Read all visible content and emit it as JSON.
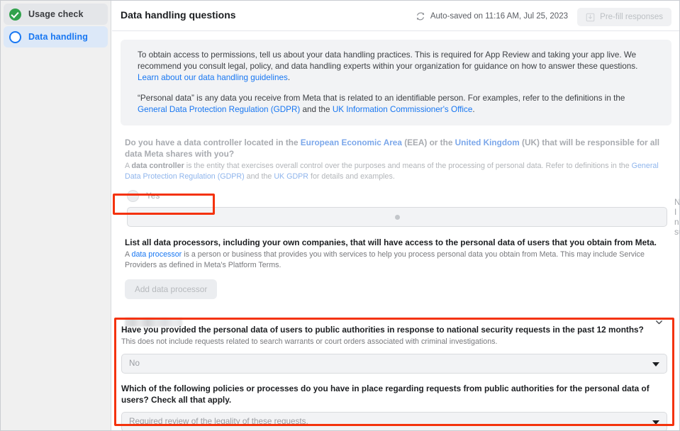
{
  "sidebar": {
    "items": [
      {
        "label": "Usage check",
        "icon": "check-circle-icon",
        "state": "done"
      },
      {
        "label": "Data handling",
        "icon": "empty-circle-icon",
        "state": "active"
      }
    ]
  },
  "header": {
    "title": "Data handling questions",
    "autosave_text": "Auto-saved on 11:16 AM, Jul 25, 2023",
    "autosave_icon": "refresh-icon",
    "prefill_label": "Pre-fill responses",
    "prefill_icon": "import-icon"
  },
  "info": {
    "p1_a": "To obtain access to permissions, tell us about your data handling practices. This is required for App Review and taking your app live. We recommend you consult legal, policy, and data handling experts within your organization for guidance on how to answer these questions. ",
    "p1_link": "Learn about our data handling guidelines",
    "p1_b": ".",
    "p2_a": "“Personal data” is any data you receive from Meta that is related to an identifiable person. For examples, refer to the definitions in the ",
    "p2_link1": "General Data Protection Regulation (GDPR)",
    "p2_mid": " and the ",
    "p2_link2": "UK Information Commissioner's Office",
    "p2_b": "."
  },
  "controller": {
    "title_a": "Do you have a data controller located in the ",
    "title_link1": "European Economic Area",
    "title_mid1": " (EEA) or the ",
    "title_link2": "United Kingdom",
    "title_b": " (UK) that will be responsible for all data Meta shares with you?",
    "sub_a": "A ",
    "sub_bold": "data controller",
    "sub_b": " is the entity that exercises overall control over the purposes and means of the processing of personal data. Refer to definitions in the ",
    "sub_link1": "General Data Protection Regulation (GDPR)",
    "sub_mid": " and the ",
    "sub_link2": "UK GDPR",
    "sub_c": " for details and examples.",
    "options": [
      {
        "label": "Yes",
        "selected": false
      },
      {
        "label": "No / I am not sure",
        "selected": true
      }
    ]
  },
  "processors": {
    "title": "List all data processors, including your own companies, that will have access to the personal data of users that you obtain from Meta.",
    "sub_a": "A ",
    "sub_link": "data processor",
    "sub_b": " is a person or business that provides you with services to help you process personal data you obtain from Meta. This may include Service Providers as defined in Meta's Platform Terms.",
    "add_button": "Add data processor",
    "row_redacted": true,
    "row_chevron_icon": "chevron-down-icon"
  },
  "government": {
    "q1_title": "Have you provided the personal data of users to public authorities in response to national security requests in the past 12 months?",
    "q1_sub": "This does not include requests related to search warrants or court orders associated with criminal investigations.",
    "q1_value": "No",
    "q1_caret_icon": "caret-down-icon",
    "q2_title": "Which of the following policies or processes do you have in place regarding requests from public authorities for the personal data of users? Check all that apply.",
    "q2_value": "Required review of the legality of these requests.",
    "q2_caret_icon": "caret-down-icon"
  },
  "colors": {
    "link": "#1877f2",
    "annotation": "#f4320c",
    "success": "#31a24c",
    "sidebar_bg": "#f0f0f0"
  }
}
